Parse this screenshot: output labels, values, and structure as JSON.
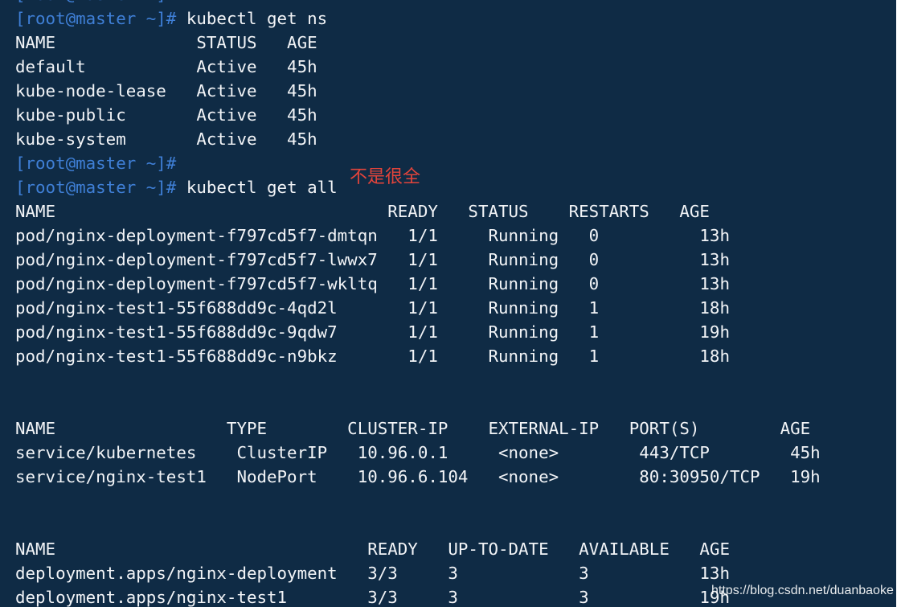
{
  "terminal": {
    "background": "#0f2b45",
    "prompt_color": "#3f7fd6",
    "text_color": "#f2f4f7",
    "annotation_color": "#e2443b",
    "lines": [
      {
        "type": "prompt",
        "prompt": "[root@master ~]#",
        "command": ""
      },
      {
        "type": "prompt",
        "prompt": "[root@master ~]#",
        "command": " kubectl get ns"
      },
      {
        "type": "output",
        "text": "NAME              STATUS   AGE"
      },
      {
        "type": "output",
        "text": "default           Active   45h"
      },
      {
        "type": "output",
        "text": "kube-node-lease   Active   45h"
      },
      {
        "type": "output",
        "text": "kube-public       Active   45h"
      },
      {
        "type": "output",
        "text": "kube-system       Active   45h"
      },
      {
        "type": "prompt",
        "prompt": "[root@master ~]#",
        "command": ""
      },
      {
        "type": "prompt",
        "prompt": "[root@master ~]#",
        "command": " kubectl get all"
      },
      {
        "type": "output",
        "text": "NAME                                 READY   STATUS    RESTARTS   AGE"
      },
      {
        "type": "output",
        "text": "pod/nginx-deployment-f797cd5f7-dmtqn   1/1     Running   0          13h"
      },
      {
        "type": "output",
        "text": "pod/nginx-deployment-f797cd5f7-lwwx7   1/1     Running   0          13h"
      },
      {
        "type": "output",
        "text": "pod/nginx-deployment-f797cd5f7-wkltq   1/1     Running   0          13h"
      },
      {
        "type": "output",
        "text": "pod/nginx-test1-55f688dd9c-4qd2l       1/1     Running   1          18h"
      },
      {
        "type": "output",
        "text": "pod/nginx-test1-55f688dd9c-9qdw7       1/1     Running   1          19h"
      },
      {
        "type": "output",
        "text": "pod/nginx-test1-55f688dd9c-n9bkz       1/1     Running   1          18h"
      },
      {
        "type": "output",
        "text": ""
      },
      {
        "type": "output",
        "text": ""
      },
      {
        "type": "output",
        "text": "NAME                 TYPE        CLUSTER-IP    EXTERNAL-IP   PORT(S)        AGE"
      },
      {
        "type": "output",
        "text": "service/kubernetes    ClusterIP   10.96.0.1     <none>        443/TCP        45h"
      },
      {
        "type": "output",
        "text": "service/nginx-test1   NodePort    10.96.6.104   <none>        80:30950/TCP   19h"
      },
      {
        "type": "output",
        "text": ""
      },
      {
        "type": "output",
        "text": ""
      },
      {
        "type": "output",
        "text": "NAME                               READY   UP-TO-DATE   AVAILABLE   AGE"
      },
      {
        "type": "output",
        "text": "deployment.apps/nginx-deployment   3/3     3            3           13h"
      },
      {
        "type": "output",
        "text": "deployment.apps/nginx-test1        3/3     3            3           19h"
      }
    ],
    "annotation": "不是很全",
    "watermark": "https://blog.csdn.net/duanbaoke"
  }
}
